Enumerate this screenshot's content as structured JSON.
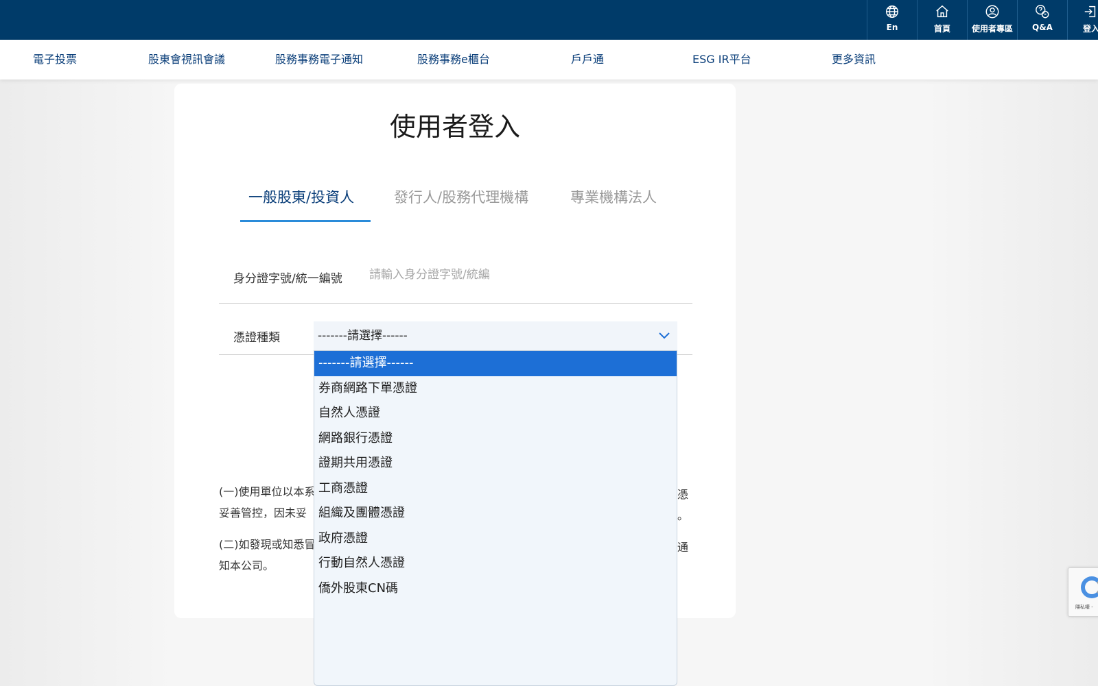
{
  "header": {
    "icons": [
      {
        "name": "globe-icon",
        "label": "En"
      },
      {
        "name": "home-icon",
        "label": "首頁"
      },
      {
        "name": "user-icon",
        "label": "使用者專區"
      },
      {
        "name": "qa-icon",
        "label": "Q&A"
      },
      {
        "name": "login-icon",
        "label": "登入"
      }
    ],
    "colors": {
      "bar": "#003b69"
    }
  },
  "nav": {
    "items": [
      "電子投票",
      "股東會視訊會議",
      "股務事務電子通知",
      "股務事務e櫃台",
      "戶戶通",
      "ESG IR平台",
      "更多資訊"
    ]
  },
  "login": {
    "title": "使用者登入",
    "tabs": [
      "一般股東/投資人",
      "發行人/股務代理機構",
      "專業機構法人"
    ],
    "id_label": "身分證字號/統一編號",
    "id_placeholder": "請輸入身分證字號/統編",
    "cert_label": "憑證種類",
    "cert_selected": "-------請選擇------",
    "cert_options": [
      "-------請選擇------",
      "券商網路下單憑證",
      "自然人憑證",
      "網路銀行憑證",
      "證期共用憑證",
      "工商憑證",
      "組織及團體憑證",
      "政府憑證",
      "行動自然人憑證",
      "僑外股東CN碼"
    ]
  },
  "terms": {
    "line1_start": "(一)使用單位以本系",
    "line1_end": "憑",
    "line2_start": "妥善管控，因未妥",
    "line2_end": "。",
    "line3_start": "(二)如發現或知悉冒",
    "line3_end": "通",
    "line4": "知本公司。"
  },
  "recaptcha": {
    "text": "隱私權 -"
  }
}
